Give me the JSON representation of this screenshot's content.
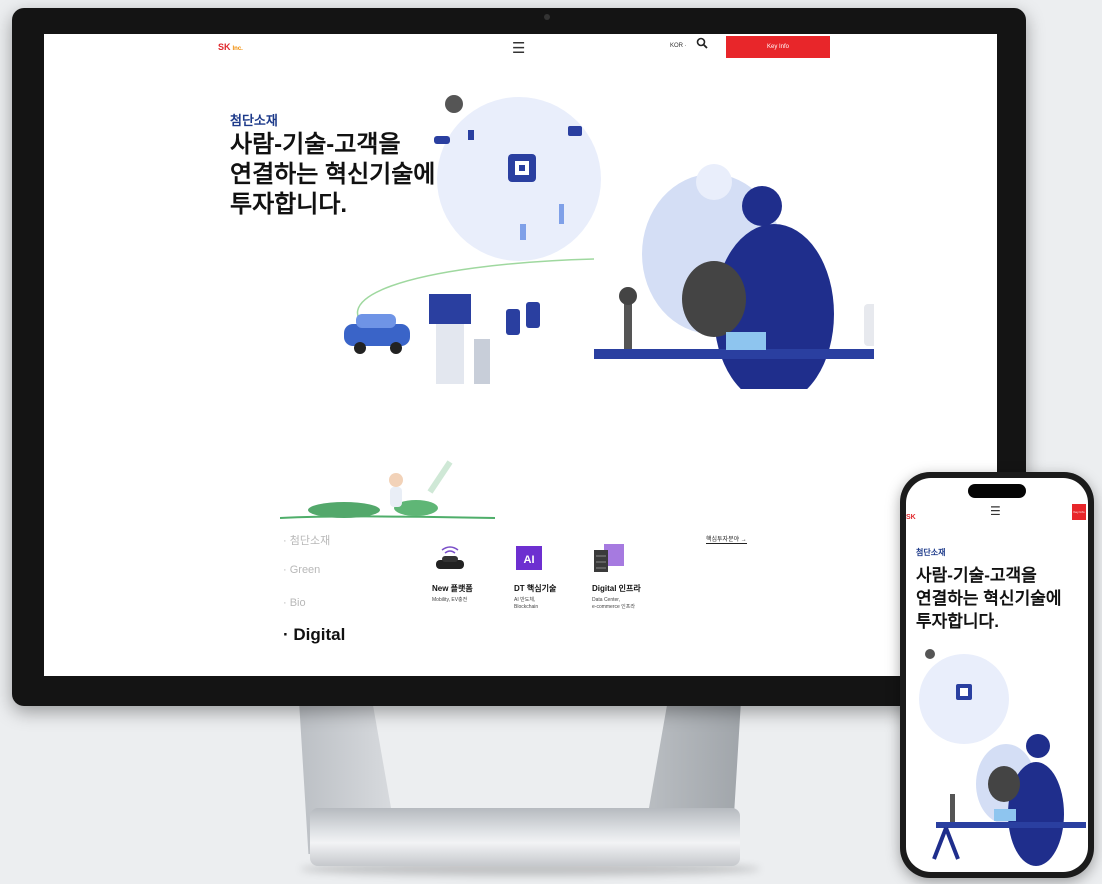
{
  "desktop": {
    "header": {
      "logo_text": "SK",
      "logo_sub": "Inc.",
      "menu_icon": "hamburger-menu-icon",
      "lang_label": "KOR ·",
      "search_icon": "search-icon",
      "keyinfo_label": "Key Info"
    },
    "hero": {
      "tag": "첨단소재",
      "headline": "사람-기술-고객을\n연결하는 혁신기술에\n투자합니다."
    },
    "menu": {
      "items": [
        "· 첨단소재",
        "· Green",
        "· Bio",
        "· Digital"
      ],
      "active_index": 3
    },
    "cards": [
      {
        "title": "New 플랫폼",
        "sub": "Mobility, EV충전"
      },
      {
        "title": "DT 핵심기술",
        "sub": "AI 반도체,\nBlockchain"
      },
      {
        "title": "Digital 인프라",
        "sub": "Data Center,\ne-commerce 인프라"
      }
    ],
    "core_link": "핵심투자분야 →",
    "colors": {
      "accent": "#e8262a",
      "navy": "#1d3a8a",
      "illustration_blue": "#2a3fa0"
    }
  },
  "phone": {
    "logo_text": "SK",
    "keyinfo_label": "Key Info",
    "tag": "첨단소재",
    "headline": "사람-기술-고객을\n연결하는 혁신기술에\n투자합니다."
  }
}
